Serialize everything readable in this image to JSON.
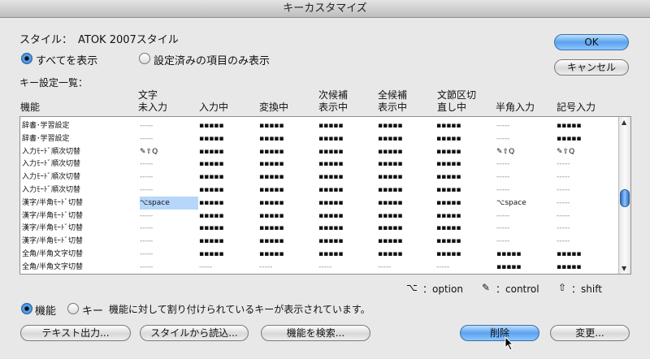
{
  "window": {
    "title": "キーカスタマイズ"
  },
  "style_label": "スタイル：",
  "style_value": "ATOK 2007スタイル",
  "view_options": {
    "all": "すべてを表示",
    "configured": "設定済みの項目のみ表示",
    "selected": "all"
  },
  "list_title": "キー設定一覧：",
  "columns": [
    {
      "key": "func",
      "line1": "",
      "line2": "機能"
    },
    {
      "key": "c1",
      "line1": "文字",
      "line2": "未入力"
    },
    {
      "key": "c2",
      "line1": "",
      "line2": "入力中"
    },
    {
      "key": "c3",
      "line1": "",
      "line2": "変換中"
    },
    {
      "key": "c4",
      "line1": "次候補",
      "line2": "表示中"
    },
    {
      "key": "c5",
      "line1": "全候補",
      "line2": "表示中"
    },
    {
      "key": "c6",
      "line1": "文節区切",
      "line2": "直し中"
    },
    {
      "key": "c7",
      "line1": "",
      "line2": "半角入力"
    },
    {
      "key": "c8",
      "line1": "",
      "line2": "記号入力"
    }
  ],
  "rows": [
    {
      "func": "辞書･学習設定",
      "cells": [
        "-----",
        "▪▪▪▪▪",
        "▪▪▪▪▪",
        "▪▪▪▪▪",
        "▪▪▪▪▪",
        "▪▪▪▪▪",
        "-----",
        "▪▪▪▪▪"
      ]
    },
    {
      "func": "辞書･学習設定",
      "cells": [
        "-----",
        "▪▪▪▪▪",
        "▪▪▪▪▪",
        "▪▪▪▪▪",
        "▪▪▪▪▪",
        "▪▪▪▪▪",
        "-----",
        "▪▪▪▪▪"
      ]
    },
    {
      "func": "入力ﾓｰﾄﾞ順次切替",
      "cells": [
        "✎⇧Q",
        "▪▪▪▪▪",
        "▪▪▪▪▪",
        "▪▪▪▪▪",
        "▪▪▪▪▪",
        "▪▪▪▪▪",
        "✎⇧Q",
        "✎⇧Q"
      ]
    },
    {
      "func": "入力ﾓｰﾄﾞ順次切替",
      "cells": [
        "-----",
        "▪▪▪▪▪",
        "▪▪▪▪▪",
        "▪▪▪▪▪",
        "▪▪▪▪▪",
        "▪▪▪▪▪",
        "-----",
        "-----"
      ]
    },
    {
      "func": "入力ﾓｰﾄﾞ順次切替",
      "cells": [
        "-----",
        "▪▪▪▪▪",
        "▪▪▪▪▪",
        "▪▪▪▪▪",
        "▪▪▪▪▪",
        "▪▪▪▪▪",
        "-----",
        "-----"
      ]
    },
    {
      "func": "入力ﾓｰﾄﾞ順次切替",
      "cells": [
        "-----",
        "▪▪▪▪▪",
        "▪▪▪▪▪",
        "▪▪▪▪▪",
        "▪▪▪▪▪",
        "▪▪▪▪▪",
        "-----",
        "-----"
      ]
    },
    {
      "func": "漢字/半角ﾓｰﾄﾞ切替",
      "cells": [
        "⌥space",
        "▪▪▪▪▪",
        "▪▪▪▪▪",
        "▪▪▪▪▪",
        "▪▪▪▪▪",
        "▪▪▪▪▪",
        "⌥space",
        "-----"
      ]
    },
    {
      "func": "漢字/半角ﾓｰﾄﾞ切替",
      "cells": [
        "-----",
        "▪▪▪▪▪",
        "▪▪▪▪▪",
        "▪▪▪▪▪",
        "▪▪▪▪▪",
        "▪▪▪▪▪",
        "-----",
        "-----"
      ]
    },
    {
      "func": "漢字/半角ﾓｰﾄﾞ切替",
      "cells": [
        "-----",
        "▪▪▪▪▪",
        "▪▪▪▪▪",
        "▪▪▪▪▪",
        "▪▪▪▪▪",
        "▪▪▪▪▪",
        "-----",
        "-----"
      ]
    },
    {
      "func": "漢字/半角ﾓｰﾄﾞ切替",
      "cells": [
        "-----",
        "▪▪▪▪▪",
        "▪▪▪▪▪",
        "▪▪▪▪▪",
        "▪▪▪▪▪",
        "▪▪▪▪▪",
        "-----",
        "-----"
      ]
    },
    {
      "func": "全角/半角文字切替",
      "cells": [
        "-----",
        "▪▪▪▪▪",
        "▪▪▪▪▪",
        "▪▪▪▪▪",
        "▪▪▪▪▪",
        "▪▪▪▪▪",
        "▪▪▪▪▪",
        "▪▪▪▪▪"
      ]
    },
    {
      "func": "全角/半角文字切替",
      "cells": [
        "-----",
        "-----",
        "-----",
        "-----",
        "-----",
        "-----",
        "▪▪▪▪▪",
        "▪▪▪▪▪"
      ]
    }
  ],
  "selected_row_index": 6,
  "selected_cell_index": 0,
  "legend": [
    {
      "icon": "option-icon",
      "glyph": "⌥",
      "text": "：option"
    },
    {
      "icon": "control-icon",
      "glyph": "✎",
      "text": "：control"
    },
    {
      "icon": "shift-icon",
      "glyph": "⇧",
      "text": "：shift"
    }
  ],
  "mode": {
    "function": "機能",
    "key": "キー",
    "selected": "function",
    "description": "機能に対して割り付けられているキーが表示されています。"
  },
  "buttons": {
    "ok": "OK",
    "cancel": "キャンセル",
    "text_output": "テキスト出力...",
    "load_style": "スタイルから読込...",
    "search": "機能を検索...",
    "delete": "削除",
    "change": "変更..."
  }
}
